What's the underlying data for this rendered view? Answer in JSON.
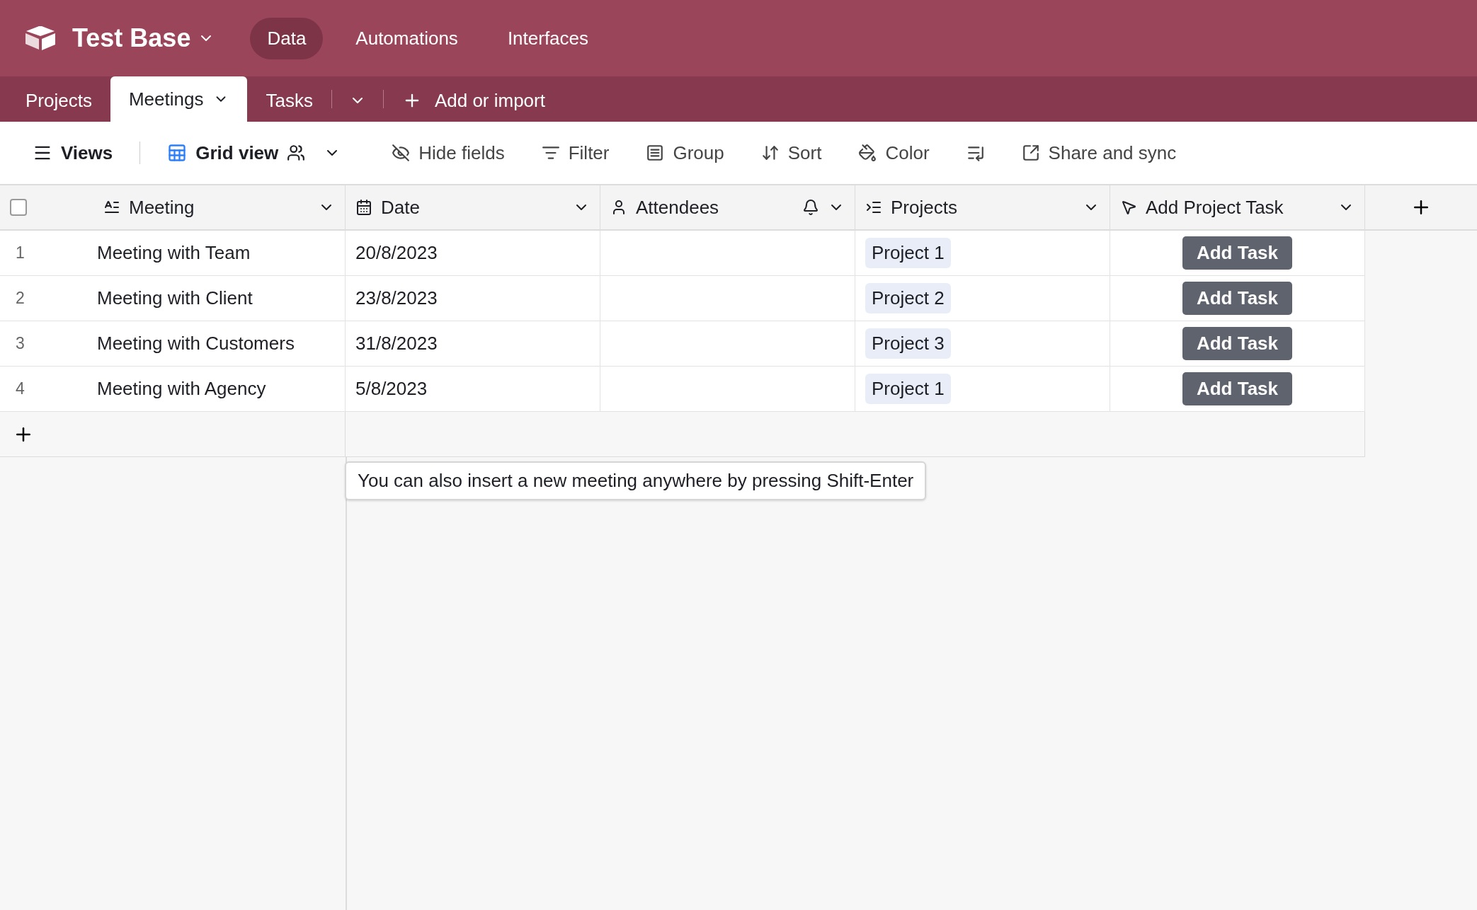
{
  "app": {
    "base_name": "Test Base"
  },
  "nav": [
    {
      "label": "Data",
      "selected": true
    },
    {
      "label": "Automations",
      "selected": false
    },
    {
      "label": "Interfaces",
      "selected": false
    }
  ],
  "table_tabs": [
    {
      "label": "Projects",
      "selected": false
    },
    {
      "label": "Meetings",
      "selected": true
    },
    {
      "label": "Tasks",
      "selected": false
    }
  ],
  "add_table": "Add or import",
  "toolbar": {
    "views": "Views",
    "view_name": "Grid view",
    "actions": [
      {
        "kind": "hide",
        "label": "Hide fields"
      },
      {
        "kind": "filter",
        "label": "Filter"
      },
      {
        "kind": "group",
        "label": "Group"
      },
      {
        "kind": "sort",
        "label": "Sort"
      },
      {
        "kind": "color",
        "label": "Color"
      },
      {
        "kind": "height"
      },
      {
        "kind": "share",
        "label": "Share and sync"
      }
    ]
  },
  "table": {
    "select_all": {
      "checked": false
    },
    "columns": [
      {
        "kind": "text",
        "label": "Meeting"
      },
      {
        "kind": "date",
        "label": "Date"
      },
      {
        "kind": "user",
        "label": "Attendees"
      },
      {
        "kind": "link",
        "label": "Projects"
      },
      {
        "kind": "button",
        "label": "Add Project Task"
      }
    ],
    "rows": [
      {
        "number": "1",
        "meeting": "Meeting with Team",
        "date": "20/8/2023",
        "project": "Project 1",
        "action": "Add Task"
      },
      {
        "number": "2",
        "meeting": "Meeting with Client",
        "date": "23/8/2023",
        "project": "Project 2",
        "action": "Add Task"
      },
      {
        "number": "3",
        "meeting": "Meeting with Customers",
        "date": "31/8/2023",
        "project": "Project 3",
        "action": "Add Task"
      },
      {
        "number": "4",
        "meeting": "Meeting with Agency",
        "date": "5/8/2023",
        "project": "Project 1",
        "action": "Add Task"
      }
    ]
  },
  "hint": "You can also insert a new meeting anywhere by pressing Shift-Enter"
}
